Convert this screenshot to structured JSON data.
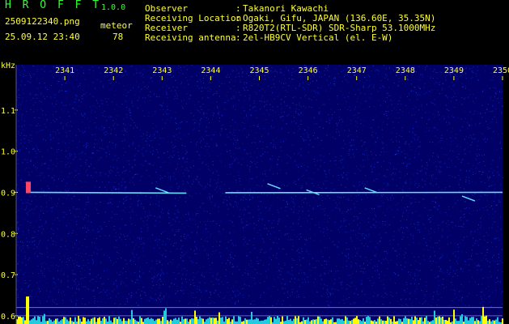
{
  "header": {
    "app_name": "H R O F F T",
    "app_version": "1.0.0",
    "filename": "2509122340.png",
    "datetime": "25.09.12 23:40",
    "meteor_label": "meteor",
    "meteor_count": "78",
    "info": [
      {
        "label": "Observer",
        "value": "Takanori Kawachi"
      },
      {
        "label": "Receiving Location",
        "value": "Ogaki, Gifu, JAPAN (136.60E, 35.35N)"
      },
      {
        "label": "Receiver",
        "value": "R820T2(RTL-SDR) SDR-Sharp 53.1000MHz"
      },
      {
        "label": "Receiving antenna",
        "value": "2el-HB9CV Vertical (el. E-W)"
      }
    ],
    "separator": ":"
  },
  "chart_data": {
    "type": "heatmap",
    "ylabel": "kHz",
    "x_ticks": [
      "2341",
      "2342",
      "2343",
      "2344",
      "2345",
      "2346",
      "2347",
      "2348",
      "2349",
      "2350"
    ],
    "y_ticks": [
      "1.1",
      "1.0",
      "0.9",
      "0.8",
      "0.7",
      "0.6"
    ],
    "y_tick_values": [
      1.1,
      1.0,
      0.9,
      0.8,
      0.7,
      0.6
    ],
    "ylim": [
      0.58,
      1.21
    ],
    "carrier_frequency": 0.9,
    "meteor_echoes": [
      {
        "minute": 2340.25,
        "freq": 0.91
      },
      {
        "minute": 2343.0,
        "freq": 0.905
      },
      {
        "minute": 2345.3,
        "freq": 0.915
      },
      {
        "minute": 2346.1,
        "freq": 0.9
      },
      {
        "minute": 2347.3,
        "freq": 0.905
      },
      {
        "minute": 2349.3,
        "freq": 0.885
      }
    ],
    "colors": {
      "background": "#000066",
      "noise": "#2244ff",
      "carrier": "#66ddff",
      "echo": "#ff4466",
      "axis_text": "#ffff33",
      "lower_signal": "#ffff00"
    }
  }
}
